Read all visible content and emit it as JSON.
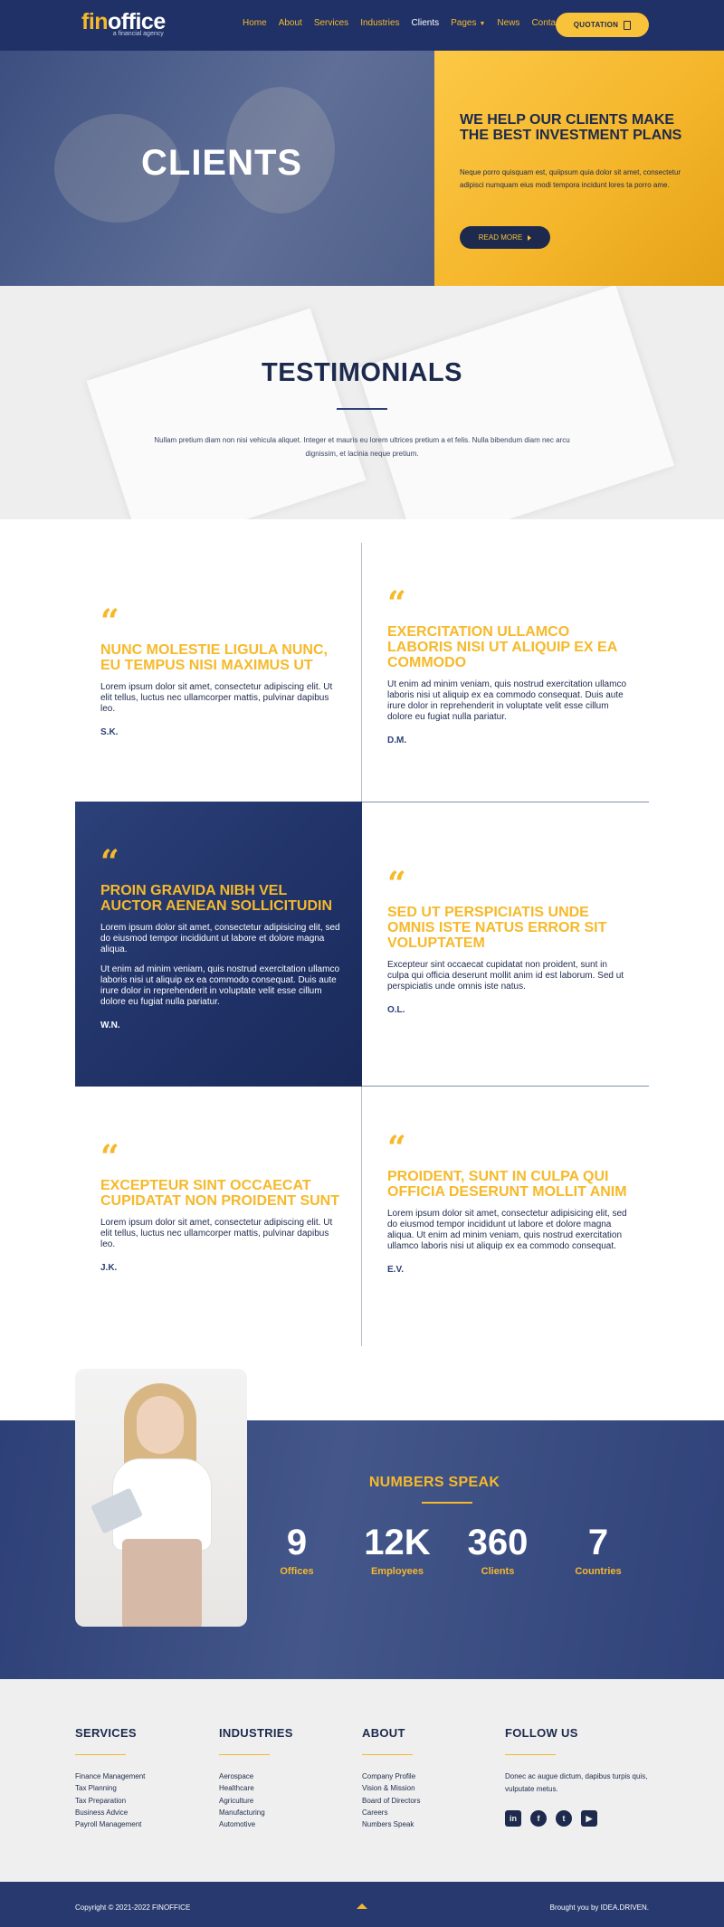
{
  "brand": {
    "logo_part1": "fin",
    "logo_part2": "office",
    "tagline": "a financial agency"
  },
  "nav": {
    "items": [
      "Home",
      "About",
      "Services",
      "Industries",
      "Clients",
      "Pages",
      "News",
      "Contact"
    ],
    "active": "Clients",
    "quote_label": "QUOTATION"
  },
  "hero": {
    "title": "CLIENTS",
    "card_heading": "WE HELP OUR CLIENTS MAKE THE BEST INVESTMENT PLANS",
    "card_text": "Neque porro quisquam est, quiipsum quia dolor sit amet, consectetur adipisci numquam eius modi tempora incidunt lores ta porro ame.",
    "read_more": "READ MORE"
  },
  "testimonials": {
    "title": "TESTIMONIALS",
    "intro": "Nullam pretium diam non nisi vehicula aliquet. Integer et mauris eu lorem ultrices pretium a et felis. Nulla bibendum diam nec arcu dignissim, et lacinia neque pretium.",
    "items": [
      {
        "heading": "NUNC MOLESTIE LIGULA NUNC, EU TEMPUS NISI MAXIMUS UT",
        "paragraphs": [
          "Lorem ipsum dolor sit amet, consectetur adipiscing elit. Ut elit tellus, luctus nec ullamcorper mattis, pulvinar dapibus leo."
        ],
        "author": "S.K."
      },
      {
        "heading": "EXERCITATION ULLAMCO LABORIS NISI UT ALIQUIP EX EA COMMODO",
        "paragraphs": [
          "Ut enim ad minim veniam, quis nostrud exercitation ullamco laboris nisi ut aliquip ex ea commodo consequat. Duis aute irure dolor in reprehenderit in voluptate velit esse cillum dolore eu fugiat nulla pariatur."
        ],
        "author": "D.M."
      },
      {
        "heading": "PROIN GRAVIDA NIBH VEL AUCTOR AENEAN SOLLICITUDIN",
        "paragraphs": [
          "Lorem ipsum dolor sit amet, consectetur adipisicing elit, sed do eiusmod tempor incididunt ut labore et dolore magna aliqua.",
          "Ut enim ad minim veniam, quis nostrud exercitation ullamco laboris nisi ut aliquip ex ea commodo consequat. Duis aute irure dolor in reprehenderit in voluptate velit esse cillum dolore eu fugiat nulla pariatur."
        ],
        "author": "W.N."
      },
      {
        "heading": "SED UT PERSPICIATIS UNDE OMNIS ISTE NATUS ERROR SIT VOLUPTATEM",
        "paragraphs": [
          "Excepteur sint occaecat cupidatat non proident, sunt in culpa qui officia deserunt mollit anim id est laborum. Sed ut perspiciatis unde omnis iste natus."
        ],
        "author": "O.L."
      },
      {
        "heading": "EXCEPTEUR SINT OCCAECAT CUPIDATAT NON PROIDENT SUNT",
        "paragraphs": [
          "Lorem ipsum dolor sit amet, consectetur adipiscing elit. Ut elit tellus, luctus nec ullamcorper mattis, pulvinar dapibus leo."
        ],
        "author": "J.K."
      },
      {
        "heading": "PROIDENT, SUNT IN CULPA QUI OFFICIA DESERUNT MOLLIT ANIM",
        "paragraphs": [
          "Lorem ipsum dolor sit amet, consectetur adipisicing elit, sed do eiusmod tempor incididunt ut labore et dolore magna aliqua. Ut enim ad minim veniam, quis nostrud exercitation ullamco laboris nisi ut aliquip ex ea commodo consequat."
        ],
        "author": "E.V."
      }
    ]
  },
  "numbers": {
    "title": "NUMBERS SPEAK",
    "stats": [
      {
        "value": "9",
        "label": "Offices"
      },
      {
        "value": "12K",
        "label": "Employees"
      },
      {
        "value": "360",
        "label": "Clients"
      },
      {
        "value": "7",
        "label": "Countries"
      }
    ]
  },
  "footer": {
    "services": {
      "title": "SERVICES",
      "items": [
        "Finance Management",
        "Tax Planning",
        "Tax Preparation",
        "Business Advice",
        "Payroll Management"
      ]
    },
    "industries": {
      "title": "INDUSTRIES",
      "items": [
        "Aerospace",
        "Healthcare",
        "Agriculture",
        "Manufacturing",
        "Automotive"
      ]
    },
    "about": {
      "title": "ABOUT",
      "items": [
        "Company Profile",
        "Vision & Mission",
        "Board of Directors",
        "Careers",
        "Numbers Speak"
      ]
    },
    "follow": {
      "title": "FOLLOW US",
      "text": "Donec ac augue dictum, dapibus turpis quis, vulputate metus.",
      "icons": [
        "linkedin-icon",
        "facebook-icon",
        "twitter-icon",
        "youtube-icon"
      ]
    },
    "copyright": "Copyright © 2021-2022 FINOFFICE",
    "credit": "Brought you by IDEA.DRIVEN."
  },
  "colors": {
    "navy": "#1f3166",
    "gold": "#f6b92b",
    "light": "#efefef"
  }
}
